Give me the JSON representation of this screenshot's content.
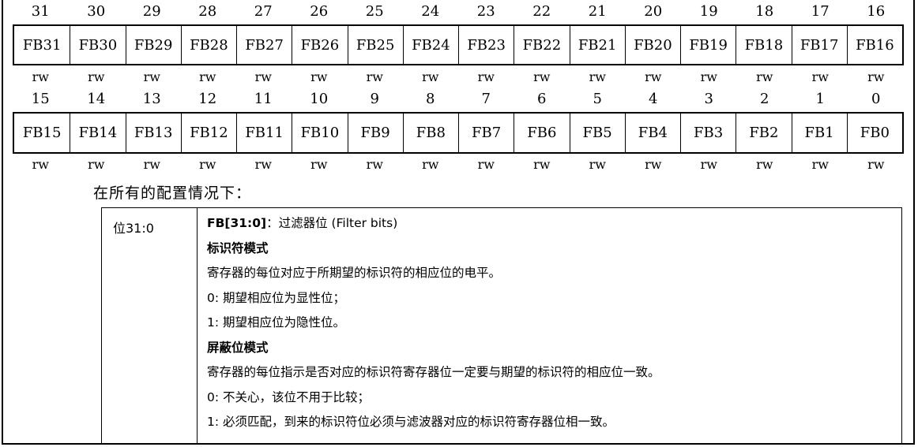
{
  "register": {
    "upper": {
      "bit_numbers": [
        "31",
        "30",
        "29",
        "28",
        "27",
        "26",
        "25",
        "24",
        "23",
        "22",
        "21",
        "20",
        "19",
        "18",
        "17",
        "16"
      ],
      "fields": [
        "FB31",
        "FB30",
        "FB29",
        "FB28",
        "FB27",
        "FB26",
        "FB25",
        "FB24",
        "FB23",
        "FB22",
        "FB21",
        "FB20",
        "FB19",
        "FB18",
        "FB17",
        "FB16"
      ],
      "access": [
        "rw",
        "rw",
        "rw",
        "rw",
        "rw",
        "rw",
        "rw",
        "rw",
        "rw",
        "rw",
        "rw",
        "rw",
        "rw",
        "rw",
        "rw",
        "rw"
      ]
    },
    "lower": {
      "bit_numbers": [
        "15",
        "14",
        "13",
        "12",
        "11",
        "10",
        "9",
        "8",
        "7",
        "6",
        "5",
        "4",
        "3",
        "2",
        "1",
        "0"
      ],
      "fields": [
        "FB15",
        "FB14",
        "FB13",
        "FB12",
        "FB11",
        "FB10",
        "FB9",
        "FB8",
        "FB7",
        "FB6",
        "FB5",
        "FB4",
        "FB3",
        "FB2",
        "FB1",
        "FB0"
      ],
      "access": [
        "rw",
        "rw",
        "rw",
        "rw",
        "rw",
        "rw",
        "rw",
        "rw",
        "rw",
        "rw",
        "rw",
        "rw",
        "rw",
        "rw",
        "rw",
        "rw"
      ]
    }
  },
  "intro": "在所有的配置情况下：",
  "description": {
    "bit_range": "位31:0",
    "field_name": "FB[31:0]",
    "field_title": "：过滤器位 (Filter bits)",
    "id_mode_heading": "标识符模式",
    "id_mode_text": "寄存器的每位对应于所期望的标识符的相应位的电平。",
    "id_mode_0": "0: 期望相应位为显性位；",
    "id_mode_1": "1: 期望相应位为隐性位。",
    "mask_mode_heading": "屏蔽位模式",
    "mask_mode_text": "寄存器的每位指示是否对应的标识符寄存器位一定要与期望的标识符的相应位一致。",
    "mask_mode_0": "0: 不关心，该位不用于比较；",
    "mask_mode_1": "1: 必须匹配，到来的标识符位必须与滤波器对应的标识符寄存器位相一致。"
  }
}
